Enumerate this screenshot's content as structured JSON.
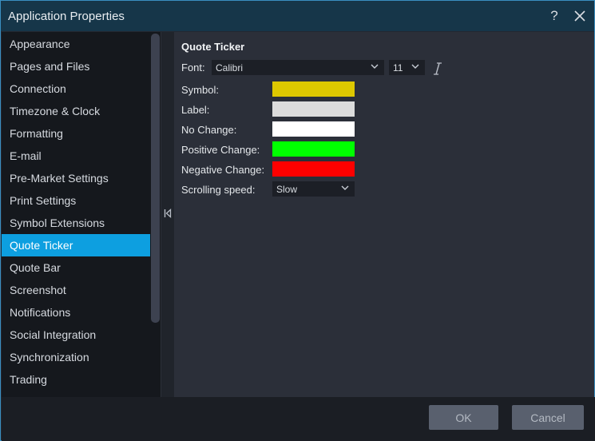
{
  "window": {
    "title": "Application Properties",
    "help_glyph": "?",
    "close_glyph": "✕",
    "accent_color": "#0d9fe0"
  },
  "sidebar": {
    "items": [
      {
        "label": "Appearance"
      },
      {
        "label": "Pages and Files"
      },
      {
        "label": "Connection"
      },
      {
        "label": "Timezone & Clock"
      },
      {
        "label": "Formatting"
      },
      {
        "label": "E-mail"
      },
      {
        "label": "Pre-Market Settings"
      },
      {
        "label": "Print Settings"
      },
      {
        "label": "Symbol Extensions"
      },
      {
        "label": "Quote Ticker"
      },
      {
        "label": "Quote Bar"
      },
      {
        "label": "Screenshot"
      },
      {
        "label": "Notifications"
      },
      {
        "label": "Social Integration"
      },
      {
        "label": "Synchronization"
      },
      {
        "label": "Trading"
      }
    ],
    "active": "Quote Ticker",
    "collapse_glyph": "⏴"
  },
  "panel": {
    "title": "Quote Ticker",
    "font_label": "Font:",
    "font_value": "Calibri",
    "font_size_value": "11",
    "symbol_label": "Symbol:",
    "symbol_color": "#ddc800",
    "label_label": "Label:",
    "label_color": "#dcdcdc",
    "no_change_label": "No Change:",
    "no_change_color": "#ffffff",
    "positive_label": "Positive Change:",
    "positive_color": "#00ff00",
    "negative_label": "Negative Change:",
    "negative_color": "#ff0000",
    "scrolling_label": "Scrolling speed:",
    "scrolling_value": "Slow"
  },
  "footer": {
    "ok_label": "OK",
    "cancel_label": "Cancel"
  }
}
